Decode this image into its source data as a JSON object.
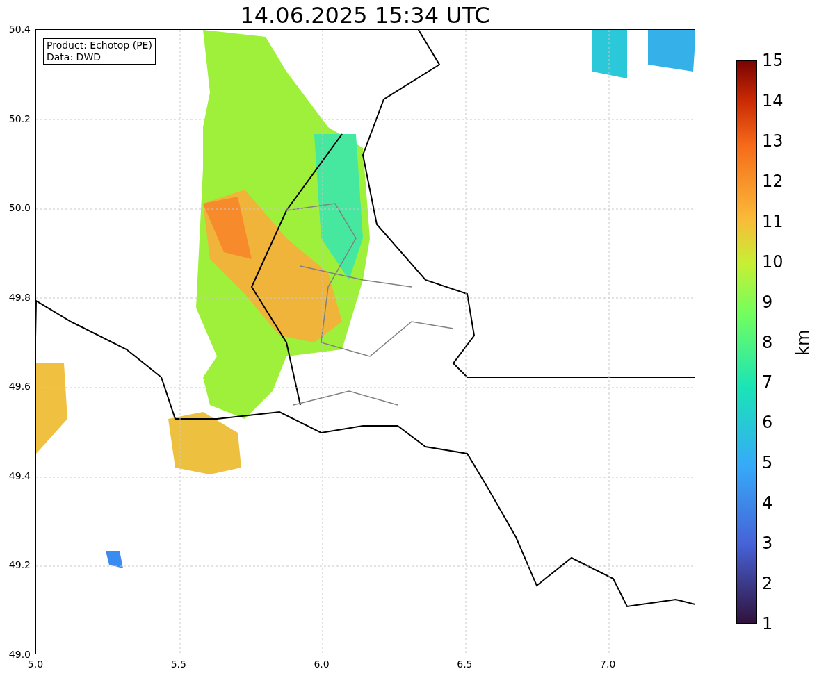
{
  "title": "14.06.2025 15:34 UTC",
  "info_box": {
    "lines": [
      "Product: Echotop (PE)",
      "Data: DWD"
    ]
  },
  "axes": {
    "xticks": [
      "5.0",
      "5.5",
      "6.0",
      "6.5",
      "7.0"
    ],
    "yticks": [
      "50.4",
      "50.2",
      "50.0",
      "49.8",
      "49.6",
      "49.4",
      "49.2",
      "49.0"
    ]
  },
  "colorbar": {
    "label": "km",
    "ticks": [
      "15",
      "14",
      "13",
      "12",
      "11",
      "10",
      "9",
      "8",
      "7",
      "6",
      "5",
      "4",
      "3",
      "2",
      "1"
    ]
  }
}
